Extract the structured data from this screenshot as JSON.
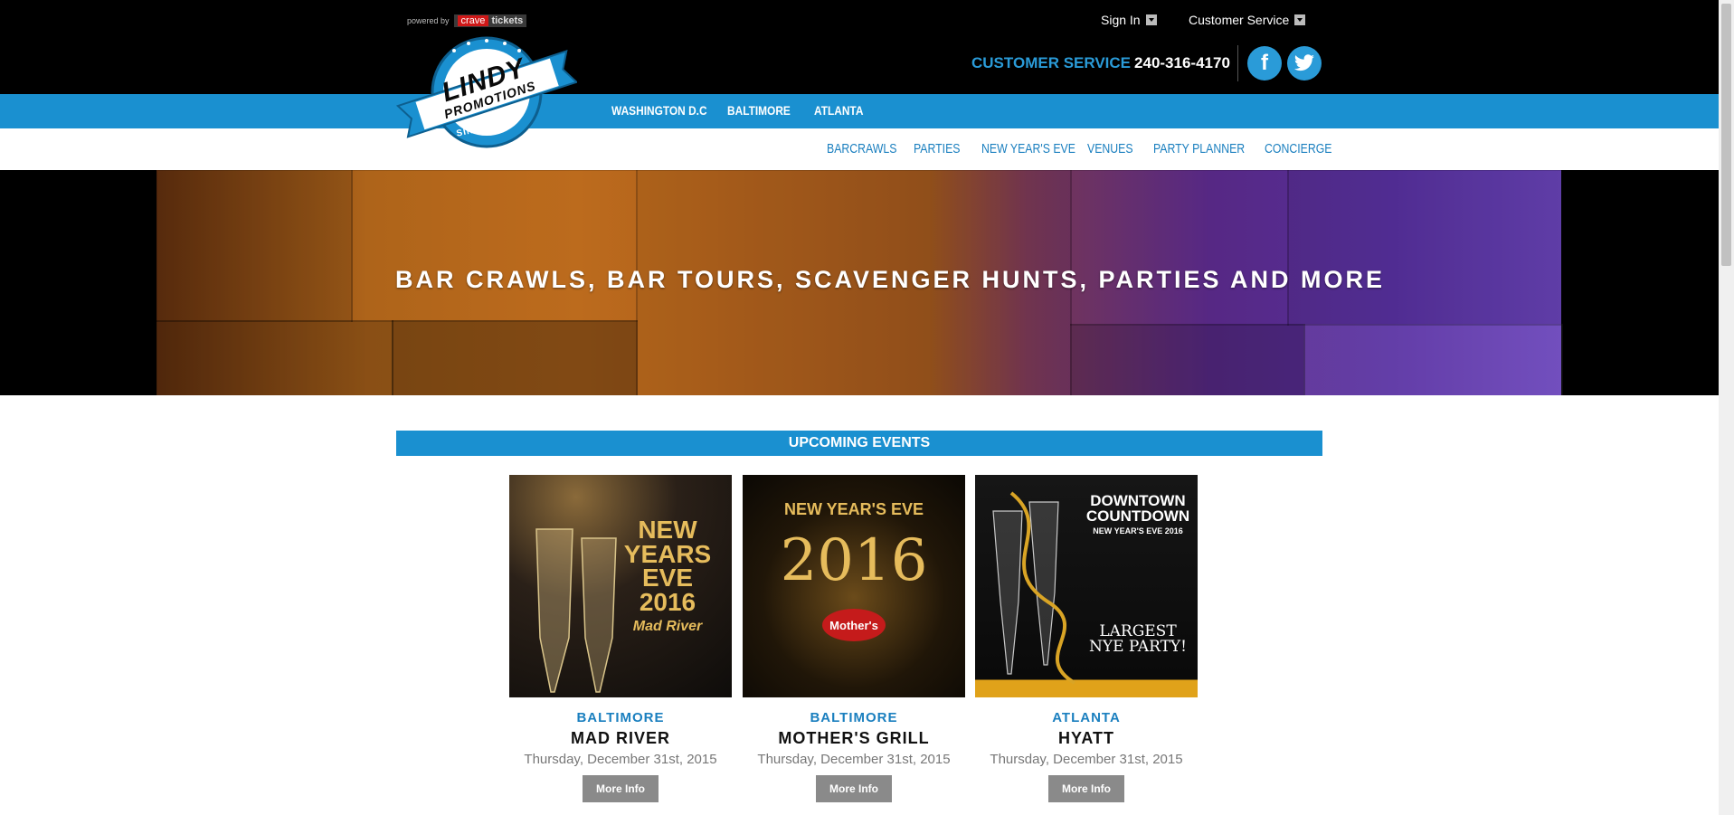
{
  "header": {
    "powered_by": "powered by",
    "crave": "crave",
    "tickets": "tickets",
    "sign_in": "Sign In",
    "customer_service_menu": "Customer Service",
    "cs_label": "CUSTOMER SERVICE",
    "cs_phone": "240-316-4170",
    "facebook_glyph": "f",
    "twitter_glyph": "t"
  },
  "logo": {
    "line1": "LINDY",
    "line2": "PROMOTIONS",
    "since": "SINCE 1993"
  },
  "city_nav": [
    "WASHINGTON D.C",
    "BALTIMORE",
    "ATLANTA"
  ],
  "sub_nav": [
    "BARCRAWLS",
    "PARTIES",
    "NEW YEAR'S EVE",
    "VENUES",
    "PARTY PLANNER",
    "CONCIERGE"
  ],
  "hero": {
    "headline": "BAR CRAWLS, BAR TOURS, SCAVENGER HUNTS, PARTIES AND MORE"
  },
  "upcoming": {
    "title": "UPCOMING EVENTS",
    "events": [
      {
        "city": "BALTIMORE",
        "venue": "MAD RIVER",
        "date": "Thursday, December 31st, 2015",
        "button": "More Info",
        "poster_lines": [
          "NEW",
          "YEARS",
          "EVE",
          "2016",
          "Mad River"
        ]
      },
      {
        "city": "BALTIMORE",
        "venue": "MOTHER'S GRILL",
        "date": "Thursday, December 31st, 2015",
        "button": "More Info",
        "poster_lines": [
          "NEW YEAR'S EVE",
          "2016",
          "Mother's"
        ]
      },
      {
        "city": "ATLANTA",
        "venue": "HYATT",
        "date": "Thursday, December 31st, 2015",
        "button": "More Info",
        "poster_lines": [
          "DOWNTOWN",
          "COUNTDOWN",
          "NEW YEAR'S EVE 2016",
          "LARGEST",
          "NYE PARTY!"
        ]
      }
    ]
  },
  "colors": {
    "brand_blue": "#1a90d0",
    "black": "#000000",
    "button_gray": "#8a8a8a"
  }
}
